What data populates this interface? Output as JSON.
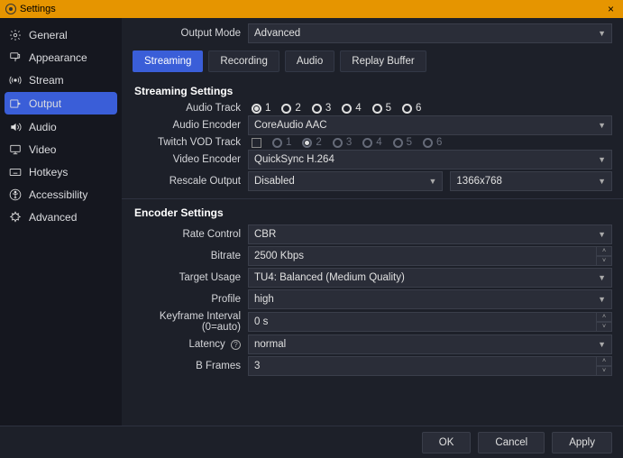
{
  "window": {
    "title": "Settings",
    "close": "×"
  },
  "sidebar": {
    "items": [
      {
        "label": "General",
        "icon": "gear-icon"
      },
      {
        "label": "Appearance",
        "icon": "paint-icon"
      },
      {
        "label": "Stream",
        "icon": "broadcast-icon"
      },
      {
        "label": "Output",
        "icon": "output-icon"
      },
      {
        "label": "Audio",
        "icon": "speaker-icon"
      },
      {
        "label": "Video",
        "icon": "monitor-icon"
      },
      {
        "label": "Hotkeys",
        "icon": "keyboard-icon"
      },
      {
        "label": "Accessibility",
        "icon": "accessibility-icon"
      },
      {
        "label": "Advanced",
        "icon": "advanced-icon"
      }
    ],
    "active_index": 3
  },
  "output_mode": {
    "label": "Output Mode",
    "value": "Advanced"
  },
  "tabs": {
    "items": [
      "Streaming",
      "Recording",
      "Audio",
      "Replay Buffer"
    ],
    "active_index": 0
  },
  "streaming_settings": {
    "title": "Streaming Settings",
    "audio_track": {
      "label": "Audio Track",
      "options": [
        "1",
        "2",
        "3",
        "4",
        "5",
        "6"
      ],
      "selected": "1"
    },
    "audio_encoder": {
      "label": "Audio Encoder",
      "value": "CoreAudio AAC"
    },
    "twitch_vod": {
      "label": "Twitch VOD Track",
      "enabled": false,
      "options": [
        "1",
        "2",
        "3",
        "4",
        "5",
        "6"
      ],
      "selected": "2"
    },
    "video_encoder": {
      "label": "Video Encoder",
      "value": "QuickSync H.264"
    },
    "rescale": {
      "label": "Rescale Output",
      "value": "Disabled",
      "size": "1366x768"
    }
  },
  "encoder_settings": {
    "title": "Encoder Settings",
    "rate_control": {
      "label": "Rate Control",
      "value": "CBR"
    },
    "bitrate": {
      "label": "Bitrate",
      "value": "2500 Kbps"
    },
    "target_usage": {
      "label": "Target Usage",
      "value": "TU4: Balanced (Medium Quality)"
    },
    "profile": {
      "label": "Profile",
      "value": "high"
    },
    "keyframe": {
      "label": "Keyframe Interval (0=auto)",
      "value": "0 s"
    },
    "latency": {
      "label": "Latency",
      "value": "normal"
    },
    "bframes": {
      "label": "B Frames",
      "value": "3"
    }
  },
  "footer": {
    "ok": "OK",
    "cancel": "Cancel",
    "apply": "Apply"
  }
}
